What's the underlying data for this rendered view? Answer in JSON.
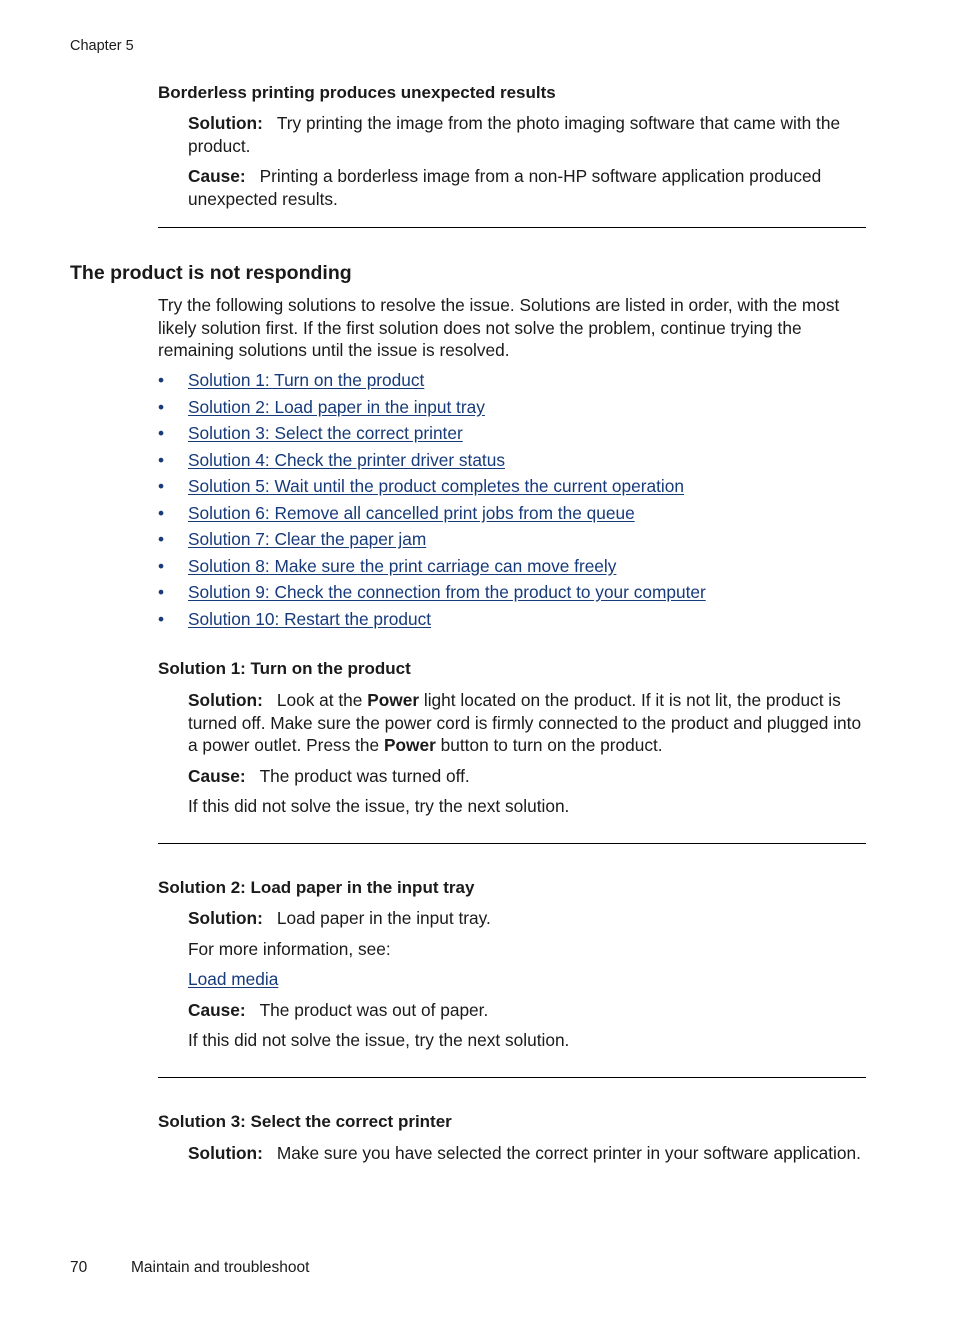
{
  "header": {
    "chapter": "Chapter 5"
  },
  "borderless": {
    "title": "Borderless printing produces unexpected results",
    "solution_label": "Solution:",
    "solution_text": "Try printing the image from the photo imaging software that came with the product.",
    "cause_label": "Cause:",
    "cause_text": "Printing a borderless image from a non-HP software application produced unexpected results."
  },
  "not_responding": {
    "title": "The product is not responding",
    "intro": "Try the following solutions to resolve the issue. Solutions are listed in order, with the most likely solution first. If the first solution does not solve the problem, continue trying the remaining solutions until the issue is resolved.",
    "bullet": "•",
    "links": [
      "Solution 1: Turn on the product",
      "Solution 2: Load paper in the input tray",
      "Solution 3: Select the correct printer",
      "Solution 4: Check the printer driver status",
      "Solution 5: Wait until the product completes the current operation",
      "Solution 6: Remove all cancelled print jobs from the queue",
      "Solution 7: Clear the paper jam",
      "Solution 8: Make sure the print carriage can move freely",
      "Solution 9: Check the connection from the product to your computer",
      "Solution 10: Restart the product"
    ]
  },
  "solution1": {
    "title": "Solution 1: Turn on the product",
    "solution_label": "Solution:",
    "text_1": "Look at the ",
    "bold_1": "Power",
    "text_2": " light located on the product. If it is not lit, the product is turned off. Make sure the power cord is firmly connected to the product and plugged into a power outlet. Press the ",
    "bold_2": "Power",
    "text_3": " button to turn on the product.",
    "cause_label": "Cause:",
    "cause_text": "The product was turned off.",
    "next": "If this did not solve the issue, try the next solution."
  },
  "solution2": {
    "title": "Solution 2: Load paper in the input tray",
    "solution_label": "Solution:",
    "solution_text": "Load paper in the input tray.",
    "more_info": "For more information, see:",
    "link": "Load media",
    "cause_label": "Cause:",
    "cause_text": "The product was out of paper.",
    "next": "If this did not solve the issue, try the next solution."
  },
  "solution3": {
    "title": "Solution 3: Select the correct printer",
    "solution_label": "Solution:",
    "solution_text": "Make sure you have selected the correct printer in your software application."
  },
  "footer": {
    "page_number": "70",
    "section": "Maintain and troubleshoot"
  }
}
